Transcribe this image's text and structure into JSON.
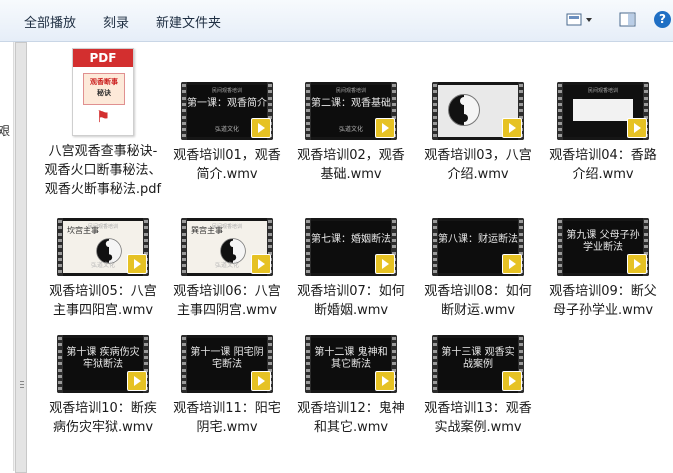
{
  "toolbar": {
    "play_all_label": "全部播放",
    "burn_label": "刻录",
    "new_folder_label": "新建文件夹"
  },
  "leftpane": {
    "cut_text": "艰"
  },
  "files": [
    {
      "name": "八宫观香查事秘诀-观香火口断事秘法、观香火断事秘法.pdf",
      "type": "pdf",
      "thumb_header": "PDF",
      "cover_line1": "观香断事",
      "cover_line2": "秘诀"
    },
    {
      "name": "观香培训01，观香简介.wmv",
      "type": "video",
      "screen_title": "第一课：观香简介",
      "screen_top": "民间观香培训",
      "screen_sub": "弘道文化"
    },
    {
      "name": "观香培训02，观香基础.wmv",
      "type": "video",
      "screen_title": "第二课：观香基础",
      "screen_top": "民间观香培训",
      "screen_sub": "弘道文化"
    },
    {
      "name": "观香培训03，八宫介绍.wmv",
      "type": "video",
      "screen_title": "",
      "screen_top": "",
      "screen_sub": ""
    },
    {
      "name": "观香培训04：香路介绍.wmv",
      "type": "video",
      "screen_title": "",
      "screen_top": "民间观香培训",
      "screen_sub": ""
    },
    {
      "name": "观香培训05：八宫主事四阳宫.wmv",
      "type": "video",
      "screen_title": "坎宫主事",
      "screen_top": "民间观香培训",
      "screen_sub": "弘道文化"
    },
    {
      "name": "观香培训06：八宫主事四阴宫.wmv",
      "type": "video",
      "screen_title": "巽宫主事",
      "screen_top": "民间观香培训",
      "screen_sub": "弘道文化"
    },
    {
      "name": "观香培训07：如何断婚姻.wmv",
      "type": "video",
      "screen_title": "第七课：婚姻断法",
      "screen_top": "",
      "screen_sub": ""
    },
    {
      "name": "观香培训08：如何断财运.wmv",
      "type": "video",
      "screen_title": "第八课：财运断法",
      "screen_top": "",
      "screen_sub": ""
    },
    {
      "name": "观香培训09：断父母子孙学业.wmv",
      "type": "video",
      "screen_title": "第九课 父母子孙学业断法",
      "screen_top": "",
      "screen_sub": ""
    },
    {
      "name": "观香培训10：断疾病伤灾牢狱.wmv",
      "type": "video",
      "screen_title": "第十课 疾病伤灾牢狱断法",
      "screen_top": "",
      "screen_sub": ""
    },
    {
      "name": "观香培训11：阳宅阴宅.wmv",
      "type": "video",
      "screen_title": "第十一课 阳宅阴宅断法",
      "screen_top": "",
      "screen_sub": ""
    },
    {
      "name": "观香培训12：鬼神和其它.wmv",
      "type": "video",
      "screen_title": "第十二课 鬼神和其它断法",
      "screen_top": "",
      "screen_sub": ""
    },
    {
      "name": "观香培训13：观香实战案例.wmv",
      "type": "video",
      "screen_title": "第十三课 观香实战案例",
      "screen_top": "",
      "screen_sub": ""
    }
  ],
  "play_badge_text": "Player",
  "colors": {
    "play_badge": "#e6c224",
    "pdf_red": "#d32f2f",
    "toolbar_bg": "#e6eef8"
  }
}
